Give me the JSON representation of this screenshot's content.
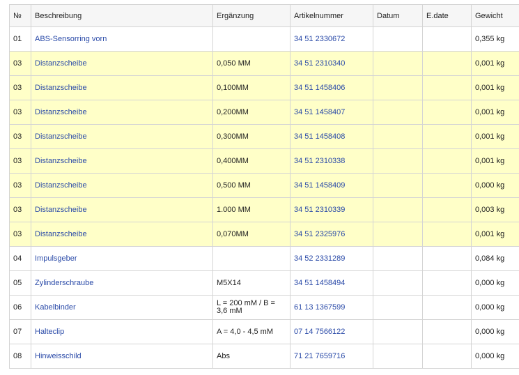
{
  "columns": [
    "№",
    "Beschreibung",
    "Ergänzung",
    "Artikelnummer",
    "Datum",
    "E.date",
    "Gewicht"
  ],
  "rows": [
    {
      "no": "01",
      "desc": "ABS-Sensorring vorn",
      "extra": "",
      "part": "34 51 2330672",
      "date": "",
      "edate": "",
      "weight": "0,355 kg",
      "highlight": false
    },
    {
      "no": "03",
      "desc": "Distanzscheibe",
      "extra": "0,050 MM",
      "part": "34 51 2310340",
      "date": "",
      "edate": "",
      "weight": "0,001 kg",
      "highlight": true
    },
    {
      "no": "03",
      "desc": "Distanzscheibe",
      "extra": "0,100MM",
      "part": "34 51 1458406",
      "date": "",
      "edate": "",
      "weight": "0,001 kg",
      "highlight": true
    },
    {
      "no": "03",
      "desc": "Distanzscheibe",
      "extra": "0,200MM",
      "part": "34 51 1458407",
      "date": "",
      "edate": "",
      "weight": "0,001 kg",
      "highlight": true
    },
    {
      "no": "03",
      "desc": "Distanzscheibe",
      "extra": "0,300MM",
      "part": "34 51 1458408",
      "date": "",
      "edate": "",
      "weight": "0,001 kg",
      "highlight": true
    },
    {
      "no": "03",
      "desc": "Distanzscheibe",
      "extra": "0,400MM",
      "part": "34 51 2310338",
      "date": "",
      "edate": "",
      "weight": "0,001 kg",
      "highlight": true
    },
    {
      "no": "03",
      "desc": "Distanzscheibe",
      "extra": "0,500 MM",
      "part": "34 51 1458409",
      "date": "",
      "edate": "",
      "weight": "0,000 kg",
      "highlight": true
    },
    {
      "no": "03",
      "desc": "Distanzscheibe",
      "extra": "1.000 MM",
      "part": "34 51 2310339",
      "date": "",
      "edate": "",
      "weight": "0,003 kg",
      "highlight": true
    },
    {
      "no": "03",
      "desc": "Distanzscheibe",
      "extra": "0,070MM",
      "part": "34 51 2325976",
      "date": "",
      "edate": "",
      "weight": "0,001 kg",
      "highlight": true
    },
    {
      "no": "04",
      "desc": "Impulsgeber",
      "extra": "",
      "part": "34 52 2331289",
      "date": "",
      "edate": "",
      "weight": "0,084 kg",
      "highlight": false
    },
    {
      "no": "05",
      "desc": "Zylinderschraube",
      "extra": "M5X14",
      "part": "34 51 1458494",
      "date": "",
      "edate": "",
      "weight": "0,000 kg",
      "highlight": false
    },
    {
      "no": "06",
      "desc": "Kabelbinder",
      "extra": "L = 200 mM / B = 3,6 mM",
      "part": "61 13 1367599",
      "date": "",
      "edate": "",
      "weight": "0,000 kg",
      "highlight": false
    },
    {
      "no": "07",
      "desc": "Halteclip",
      "extra": "A = 4,0 - 4,5 mM",
      "part": "07 14 7566122",
      "date": "",
      "edate": "",
      "weight": "0,000 kg",
      "highlight": false
    },
    {
      "no": "08",
      "desc": "Hinweisschild",
      "extra": "Abs",
      "part": "71 21 7659716",
      "date": "",
      "edate": "",
      "weight": "0,000 kg",
      "highlight": false
    }
  ],
  "colors": {
    "highlight": "#ffffc8",
    "link": "#2a4aa8",
    "border": "#d4d4d4"
  }
}
